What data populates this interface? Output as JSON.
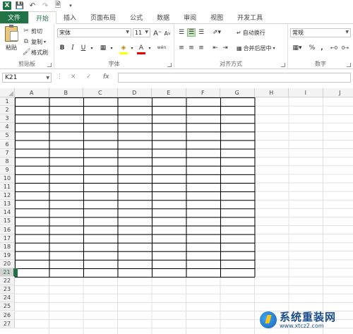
{
  "quick_access": {
    "icons": [
      "excel-logo",
      "save-icon",
      "undo-icon",
      "redo-icon",
      "print-preview-icon"
    ]
  },
  "tabs": [
    {
      "label": "文件"
    },
    {
      "label": "开始"
    },
    {
      "label": "插入"
    },
    {
      "label": "页面布局"
    },
    {
      "label": "公式"
    },
    {
      "label": "数据"
    },
    {
      "label": "审阅"
    },
    {
      "label": "视图"
    },
    {
      "label": "开发工具"
    }
  ],
  "active_tab": "开始",
  "ribbon": {
    "clipboard": {
      "group_label": "剪贴板",
      "paste": "粘贴",
      "cut": "剪切",
      "copy": "复制",
      "format_painter": "格式刷"
    },
    "font": {
      "group_label": "字体",
      "font_name": "宋体",
      "font_size": "11",
      "bold": "B",
      "italic": "I",
      "underline": "U",
      "grow": "A",
      "shrink": "A",
      "phonetic": "wén"
    },
    "alignment": {
      "group_label": "对齐方式",
      "wrap_text": "自动换行",
      "merge_center": "合并后居中"
    },
    "number": {
      "group_label": "数字",
      "format": "常规",
      "percent": "%",
      "comma": ","
    }
  },
  "formula_bar": {
    "name_box": "K21",
    "formula": ""
  },
  "sheet": {
    "columns": [
      "A",
      "B",
      "C",
      "D",
      "E",
      "F",
      "G",
      "H",
      "I",
      "J"
    ],
    "rows": [
      "1",
      "2",
      "3",
      "4",
      "5",
      "6",
      "7",
      "8",
      "9",
      "10",
      "11",
      "12",
      "13",
      "14",
      "15",
      "16",
      "17",
      "18",
      "19",
      "20",
      "21",
      "22",
      "23",
      "24",
      "25",
      "26",
      "27"
    ],
    "selected_row": "21",
    "bordered_range": "A1:G21"
  },
  "watermark": {
    "title": "系统重装网",
    "url": "www.xtcz2.com"
  },
  "colors": {
    "accent": "#217346",
    "selected_align": "#c5e0b4"
  }
}
